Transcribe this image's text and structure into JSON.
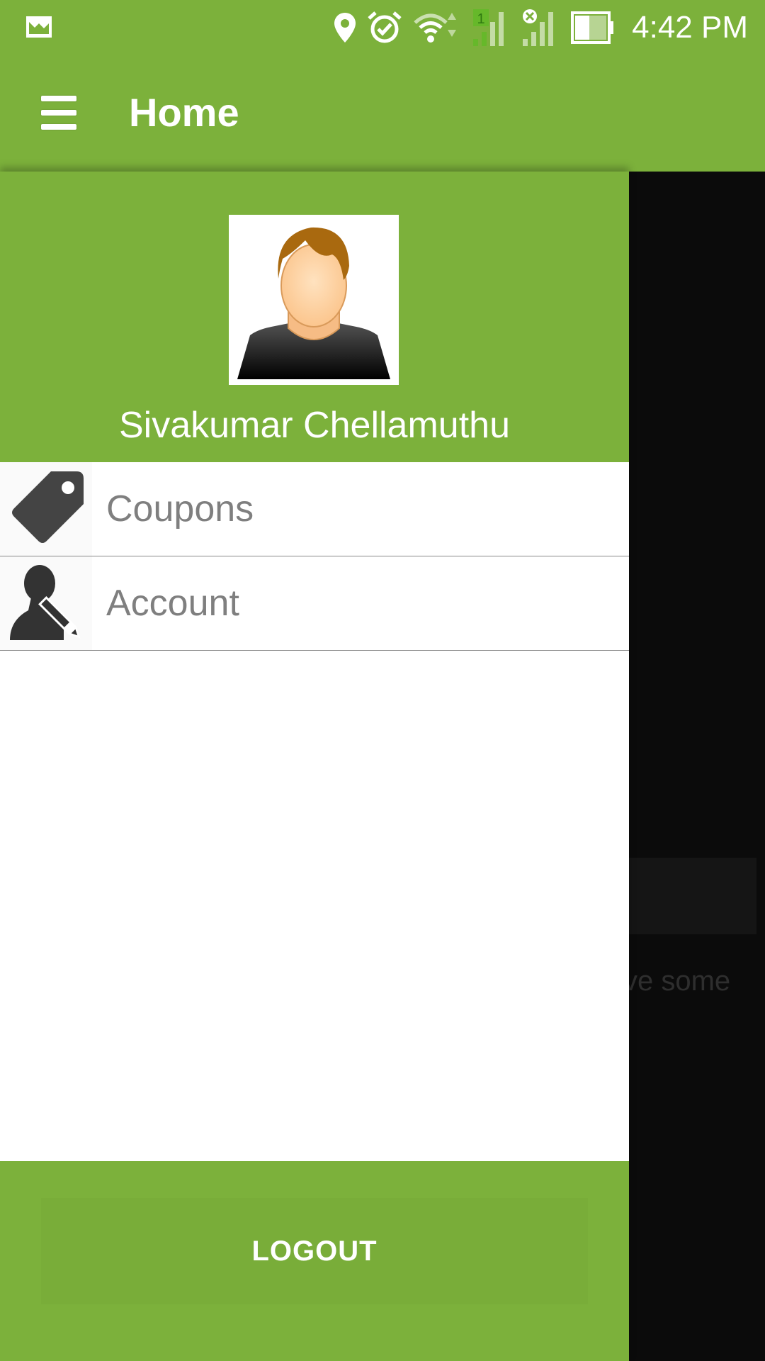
{
  "status_bar": {
    "time": "4:42 PM",
    "icons": [
      "image-icon",
      "location-icon",
      "alarm-icon",
      "wifi-icon",
      "signal-sim1-icon",
      "signal-sim2-no-service-icon",
      "battery-icon"
    ],
    "sim_label": "1"
  },
  "toolbar": {
    "title": "Home",
    "menu_icon": "hamburger-menu-icon"
  },
  "drawer": {
    "user_name": "Sivakumar Chellamuthu",
    "avatar_icon": "user-avatar",
    "items": [
      {
        "label": "Coupons",
        "icon": "tag-icon"
      },
      {
        "label": "Account",
        "icon": "account-edit-icon"
      }
    ],
    "logout_label": "LOGOUT"
  },
  "background_content": {
    "partial_text": "ve some"
  },
  "colors": {
    "primary": "#7cb13b",
    "scrim": "#0b0b0b",
    "icon_dark": "#444444",
    "item_text": "#7f7f7f"
  }
}
